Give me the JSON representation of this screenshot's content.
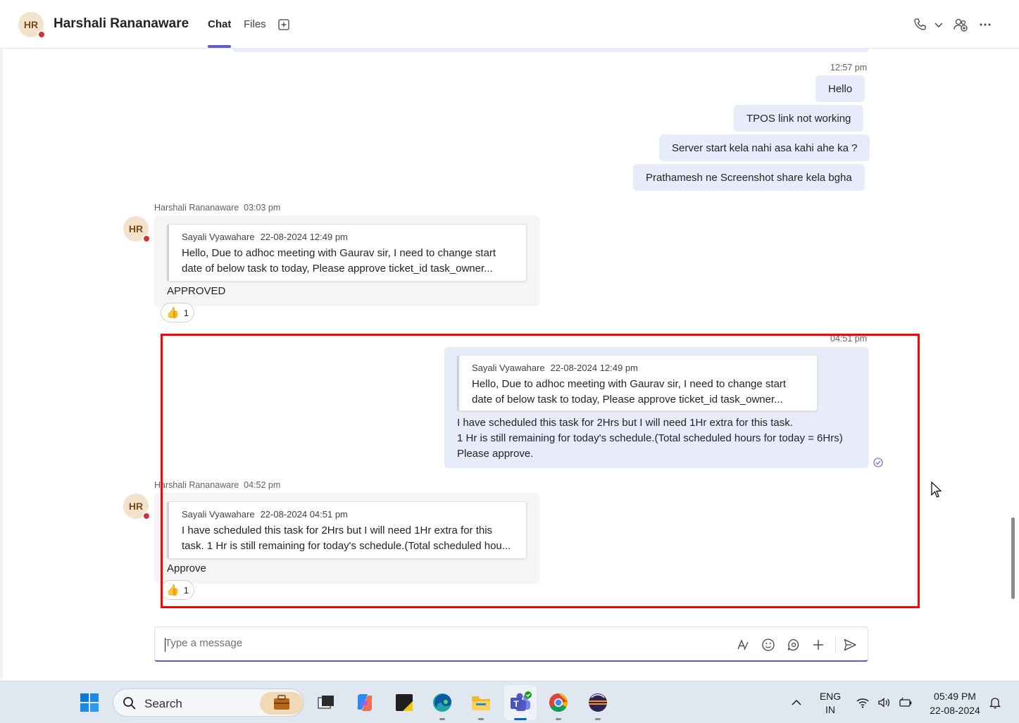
{
  "header": {
    "avatar_initials": "HR",
    "contact_name": "Harshali Rananaware",
    "tabs": [
      {
        "label": "Chat"
      },
      {
        "label": "Files"
      }
    ],
    "accent_color": "#5b5fc7",
    "presence_color": "#d13438"
  },
  "messages": {
    "outgoing_group_1": {
      "time": "12:57 pm",
      "lines": [
        "Hello",
        "TPOS link not working",
        "Server start kela nahi asa kahi ahe ka ?",
        "Prathamesh ne Screenshot share kela bgha"
      ]
    },
    "incoming_1": {
      "sender": "Harshali Rananaware",
      "time": "03:03 pm",
      "avatar_initials": "HR",
      "quote": {
        "author": "Sayali Vyawahare",
        "date": "22-08-2024 12:49 pm",
        "line1": "Hello, Due to adhoc meeting with Gaurav sir, I need to change start",
        "line2": "date of below task to today, Please approve ticket_id task_owner..."
      },
      "text": "APPROVED",
      "reaction": {
        "emoji": "👍",
        "count": "1"
      }
    },
    "outgoing_2": {
      "time": "04:51 pm",
      "quote": {
        "author": "Sayali Vyawahare",
        "date": "22-08-2024 12:49 pm",
        "line1": "Hello, Due to adhoc meeting with Gaurav sir, I need to change start",
        "line2": "date of below task to today, Please approve ticket_id task_owner..."
      },
      "line1": "I have scheduled this task for 2Hrs but I will need 1Hr extra for this task.",
      "line2": "1 Hr is still remaining for today's schedule.(Total scheduled hours for today = 6Hrs)",
      "line3": "Please approve."
    },
    "incoming_2": {
      "sender": "Harshali Rananaware",
      "time": "04:52 pm",
      "avatar_initials": "HR",
      "quote": {
        "author": "Sayali Vyawahare",
        "date": "22-08-2024 04:51 pm",
        "line1": "I have scheduled this task for 2Hrs but I will need 1Hr extra for this",
        "line2": "task. 1 Hr is still remaining for today's schedule.(Total scheduled hou..."
      },
      "text": "Approve",
      "reaction": {
        "emoji": "👍",
        "count": "1"
      }
    }
  },
  "compose": {
    "placeholder": "Type a message"
  },
  "taskbar": {
    "search_label": "Search",
    "language_line1": "ENG",
    "language_line2": "IN",
    "time": "05:49 PM",
    "date": "22-08-2024"
  }
}
